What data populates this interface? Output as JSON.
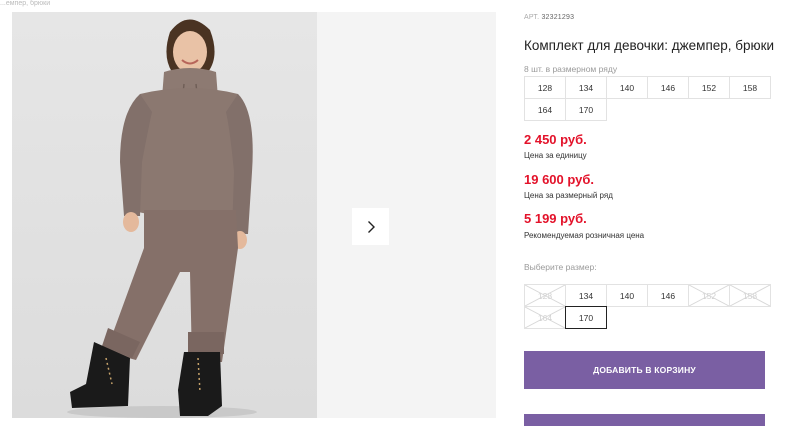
{
  "breadcrumb": "...емпер, брюки",
  "product": {
    "art_label": "АРТ.",
    "art_number": "32321293",
    "title": "Комплект для девочки: джемпер, брюки"
  },
  "pack": {
    "label": "8 шт. в размерном ряду",
    "sizes": [
      "128",
      "134",
      "140",
      "146",
      "152",
      "158",
      "164",
      "170"
    ]
  },
  "prices": [
    {
      "value": "2 450 руб.",
      "label": "Цена за единицу"
    },
    {
      "value": "19 600 руб.",
      "label": "Цена за размерный ряд"
    },
    {
      "value": "5 199 руб.",
      "label": "Рекомендуемая розничная цена"
    }
  ],
  "size_select": {
    "label": "Выберите размер:",
    "sizes": [
      {
        "value": "128",
        "available": false,
        "selected": false
      },
      {
        "value": "134",
        "available": true,
        "selected": false
      },
      {
        "value": "140",
        "available": true,
        "selected": false
      },
      {
        "value": "146",
        "available": true,
        "selected": false
      },
      {
        "value": "152",
        "available": false,
        "selected": false
      },
      {
        "value": "158",
        "available": false,
        "selected": false
      },
      {
        "value": "164",
        "available": false,
        "selected": false
      },
      {
        "value": "170",
        "available": true,
        "selected": true
      }
    ]
  },
  "add_to_cart": "ДОБАВИТЬ В КОРЗИНУ",
  "gallery": {
    "next_icon": "chevron-right-icon"
  },
  "colors": {
    "accent": "#7a5fa3",
    "price": "#e3122a"
  }
}
